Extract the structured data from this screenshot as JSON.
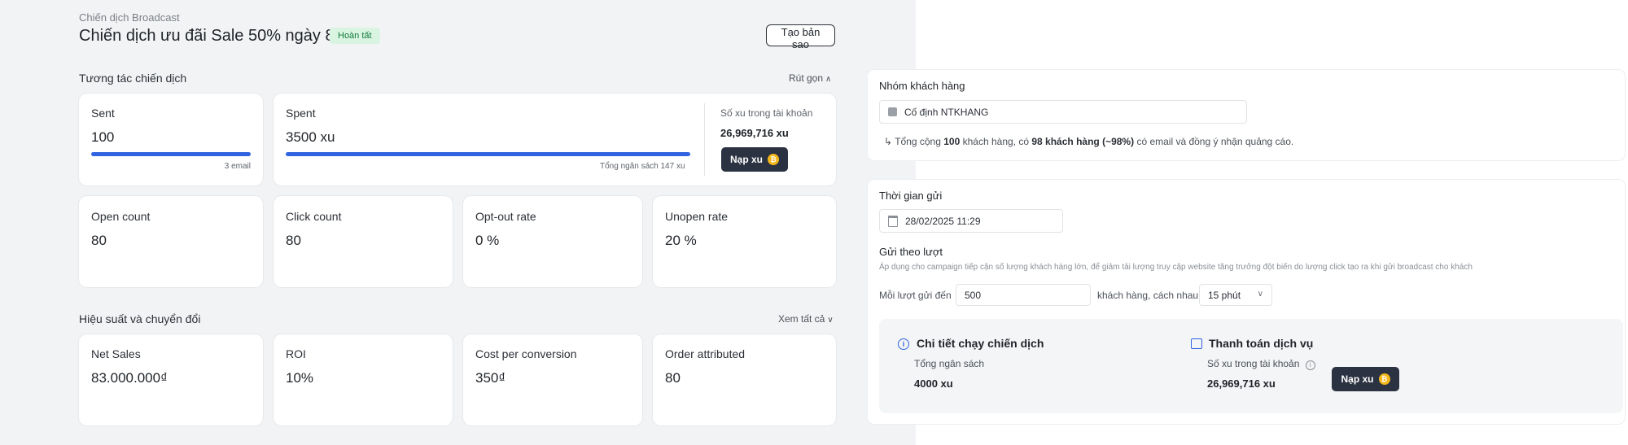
{
  "header": {
    "breadcrumb": "Chiến dịch Broadcast",
    "title": "Chiến dịch ưu đãi Sale 50% ngày 8/3",
    "status": "Hoàn tất",
    "copy_button": "Tạo bản sao"
  },
  "engagement": {
    "title": "Tương tác chiến dịch",
    "toggle": "Rút gọn",
    "sent": {
      "label": "Sent",
      "value": "100",
      "caption": "3 email",
      "progress": 1.0
    },
    "spent": {
      "label": "Spent",
      "value": "3500 xu",
      "caption": "Tổng ngân sách 147 xu",
      "progress": 1.0,
      "balance_label": "Số xu trong tài khoản",
      "balance_value": "26,969,716 xu",
      "topup_label": "Nạp xu"
    },
    "metrics": [
      {
        "label": "Open count",
        "value": "80"
      },
      {
        "label": "Click count",
        "value": "80"
      },
      {
        "label": "Opt-out rate",
        "value": "0 %"
      },
      {
        "label": "Unopen rate",
        "value": "20 %"
      }
    ]
  },
  "performance": {
    "title": "Hiệu suất và chuyển đổi",
    "toggle": "Xem tất cả",
    "metrics": [
      {
        "label": "Net Sales",
        "value": "83.000.000₫"
      },
      {
        "label": "ROI",
        "value": "10%"
      },
      {
        "label": "Cost per conversion",
        "value": "350₫"
      },
      {
        "label": "Order attributed",
        "value": "80"
      }
    ]
  },
  "audience": {
    "label": "Nhóm khách hàng",
    "group_value": "Cố định NTKHANG",
    "summary_prefix": "Tổng cộng",
    "summary_total": "100",
    "summary_mid": "khách hàng, có",
    "summary_eligible": "98 khách hàng (~98%)",
    "summary_suffix": "có email và đồng ý nhận quảng cáo."
  },
  "schedule": {
    "label": "Thời gian gửi",
    "datetime_value": "28/02/2025 11:29",
    "batch_label": "Gửi theo lượt",
    "batch_note": "Áp dụng cho campaign tiếp cận số lượng khách hàng lớn, để giảm tải lượng truy cập website tăng trưởng đột biến do lượng click tạo ra khi gửi broadcast cho khách",
    "per_batch_label": "Mỗi lượt gửi đến",
    "per_batch_value": "500",
    "interval_label": "khách hàng, cách nhau",
    "interval_value": "15 phút"
  },
  "details": {
    "run_title": "Chi tiết chạy chiến dịch",
    "budget_label": "Tổng ngân sách",
    "budget_value": "4000 xu",
    "payment_title": "Thanh toán dịch vụ",
    "balance_label": "Số xu trong tài khoản",
    "balance_value": "26,969,716 xu",
    "topup_label": "Nạp xu"
  },
  "colors": {
    "accent": "#2f63e0",
    "badge_bg": "#d9f5e2",
    "badge_text": "#137a3a",
    "dark_button": "#2b3241",
    "coin": "#f5b71a"
  }
}
